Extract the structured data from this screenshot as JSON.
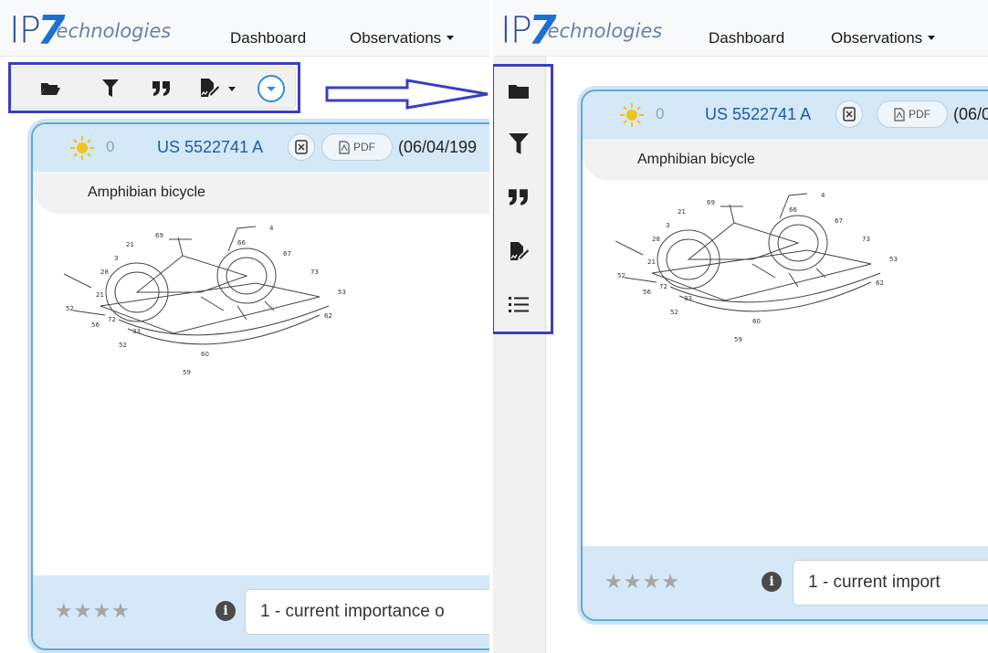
{
  "left_panel": {
    "nav": {
      "logo_ip": "IP",
      "logo_seven": "7",
      "logo_tech": "echnologies",
      "dashboard": "Dashboard",
      "observations": "Observations"
    },
    "toolbar": {
      "icons": [
        "folder-open-icon",
        "filter-icon",
        "quote-icon",
        "file-signature-icon",
        "chevron-down-circle-icon"
      ]
    },
    "card": {
      "score": "0",
      "patent_number": "US 5522741 A",
      "pdf_label": "PDF",
      "date": "(06/04/199",
      "title": "Amphibian bicycle",
      "stars": "★★★★",
      "importance": "1 - current importance o"
    }
  },
  "right_panel": {
    "nav": {
      "logo_ip": "IP",
      "logo_seven": "7",
      "logo_tech": "echnologies",
      "dashboard": "Dashboard",
      "observations": "Observations"
    },
    "vertical_toolbar": {
      "icons": [
        "folder-icon",
        "filter-icon",
        "quote-icon",
        "file-signature-icon",
        "list-icon"
      ]
    },
    "card": {
      "score": "0",
      "patent_number": "US 5522741 A",
      "pdf_label": "PDF",
      "date": "(06/0",
      "title": "Amphibian bicycle",
      "stars": "★★★★",
      "importance": "1 - current import"
    }
  },
  "colors": {
    "highlight": "#3a3fbf",
    "card_border": "#62a8d8",
    "card_header": "#d4e8f7",
    "sun": "#f0c419"
  }
}
